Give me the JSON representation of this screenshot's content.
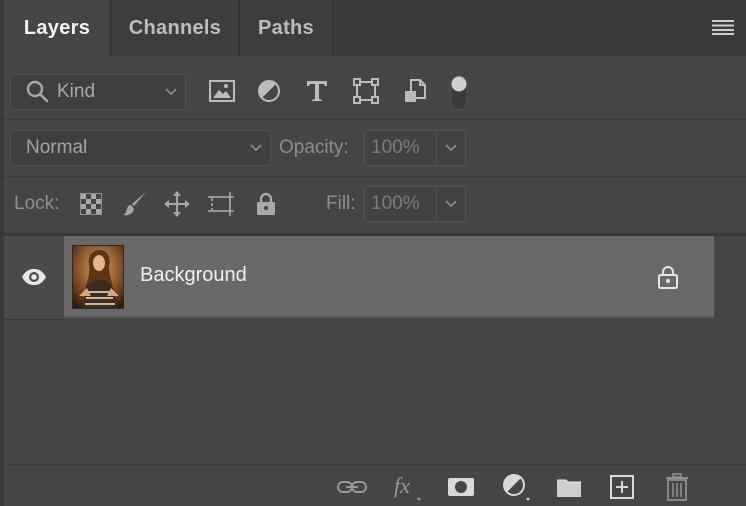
{
  "tabs": [
    {
      "label": "Layers",
      "active": true
    },
    {
      "label": "Channels",
      "active": false
    },
    {
      "label": "Paths",
      "active": false
    }
  ],
  "filter": {
    "kind_label": "Kind",
    "icons": [
      "image-filter-icon",
      "adjustment-filter-icon",
      "type-filter-icon",
      "shape-filter-icon",
      "smart-object-filter-icon"
    ],
    "filter_toggle_on": false
  },
  "blend": {
    "mode": "Normal",
    "opacity_label": "Opacity:",
    "opacity_value": "100%"
  },
  "lock": {
    "label": "Lock:",
    "fill_label": "Fill:",
    "fill_value": "100%"
  },
  "layers": [
    {
      "name": "Background",
      "visible": true,
      "locked": true
    }
  ],
  "bottom_actions": [
    "link-layers-icon",
    "fx-icon",
    "add-mask-icon",
    "adjustment-layer-icon",
    "new-group-icon",
    "new-layer-icon",
    "delete-layer-icon"
  ],
  "colors": {
    "panel_bg": "#454545",
    "selected_layer_bg": "#696969",
    "tab_active_bg": "#454545"
  }
}
